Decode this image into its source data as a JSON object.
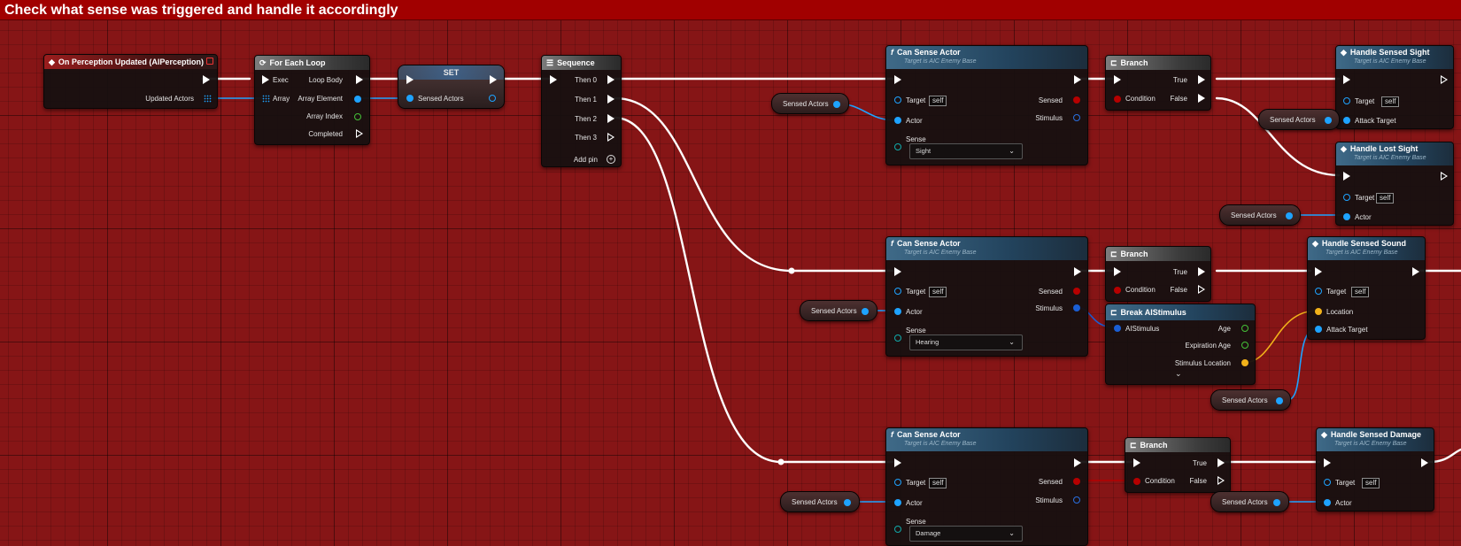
{
  "title": "Check what sense was triggered and handle it accordingly",
  "colors": {
    "background": "#861516",
    "title_bar": "#a10000",
    "exec_wire": "#ffffff",
    "object_pin": "#1ea3ff",
    "bool_pin": "#b60000",
    "vector_pin": "#f2b21a",
    "float_pin": "#45c238",
    "struct_pin": "#1a5ed4"
  },
  "event": {
    "title": "On Perception Updated (AIPerception)",
    "out_pin": "Updated Actors"
  },
  "foreach": {
    "title": "For Each Loop",
    "exec": "Exec",
    "array": "Array",
    "loop_body": "Loop Body",
    "array_element": "Array Element",
    "array_index": "Array Index",
    "completed": "Completed"
  },
  "set": {
    "title": "SET",
    "pin": "Sensed Actors"
  },
  "sequence": {
    "title": "Sequence",
    "then0": "Then 0",
    "then1": "Then 1",
    "then2": "Then 2",
    "then3": "Then 3",
    "add_pin": "Add pin"
  },
  "can_sense": {
    "title": "Can Sense Actor",
    "subtitle": "Target is AIC Enemy Base",
    "target": "Target",
    "target_value": "self",
    "actor": "Actor",
    "sense": "Sense",
    "sensed": "Sensed",
    "stimulus": "Stimulus",
    "sense_values": [
      "Sight",
      "Hearing",
      "Damage"
    ]
  },
  "branch": {
    "title": "Branch",
    "condition": "Condition",
    "true": "True",
    "false": "False"
  },
  "var_label": "Sensed Actors",
  "handle_sight": {
    "title": "Handle Sensed Sight",
    "subtitle": "Target is AIC Enemy Base",
    "target": "Target",
    "target_value": "self",
    "attack": "Attack Target"
  },
  "handle_lost": {
    "title": "Handle Lost Sight",
    "subtitle": "Target is AIC Enemy Base",
    "target": "Target",
    "target_value": "self",
    "actor": "Actor"
  },
  "handle_sound": {
    "title": "Handle Sensed Sound",
    "subtitle": "Target is AIC Enemy Base",
    "target": "Target",
    "target_value": "self",
    "location": "Location",
    "attack": "Attack Target"
  },
  "break_stim": {
    "title": "Break AIStimulus",
    "in": "AIStimulus",
    "age": "Age",
    "expiration": "Expiration Age",
    "location": "Stimulus Location"
  },
  "handle_damage": {
    "title": "Handle Sensed Damage",
    "subtitle": "Target is AIC Enemy Base",
    "target": "Target",
    "target_value": "self",
    "actor": "Actor"
  }
}
